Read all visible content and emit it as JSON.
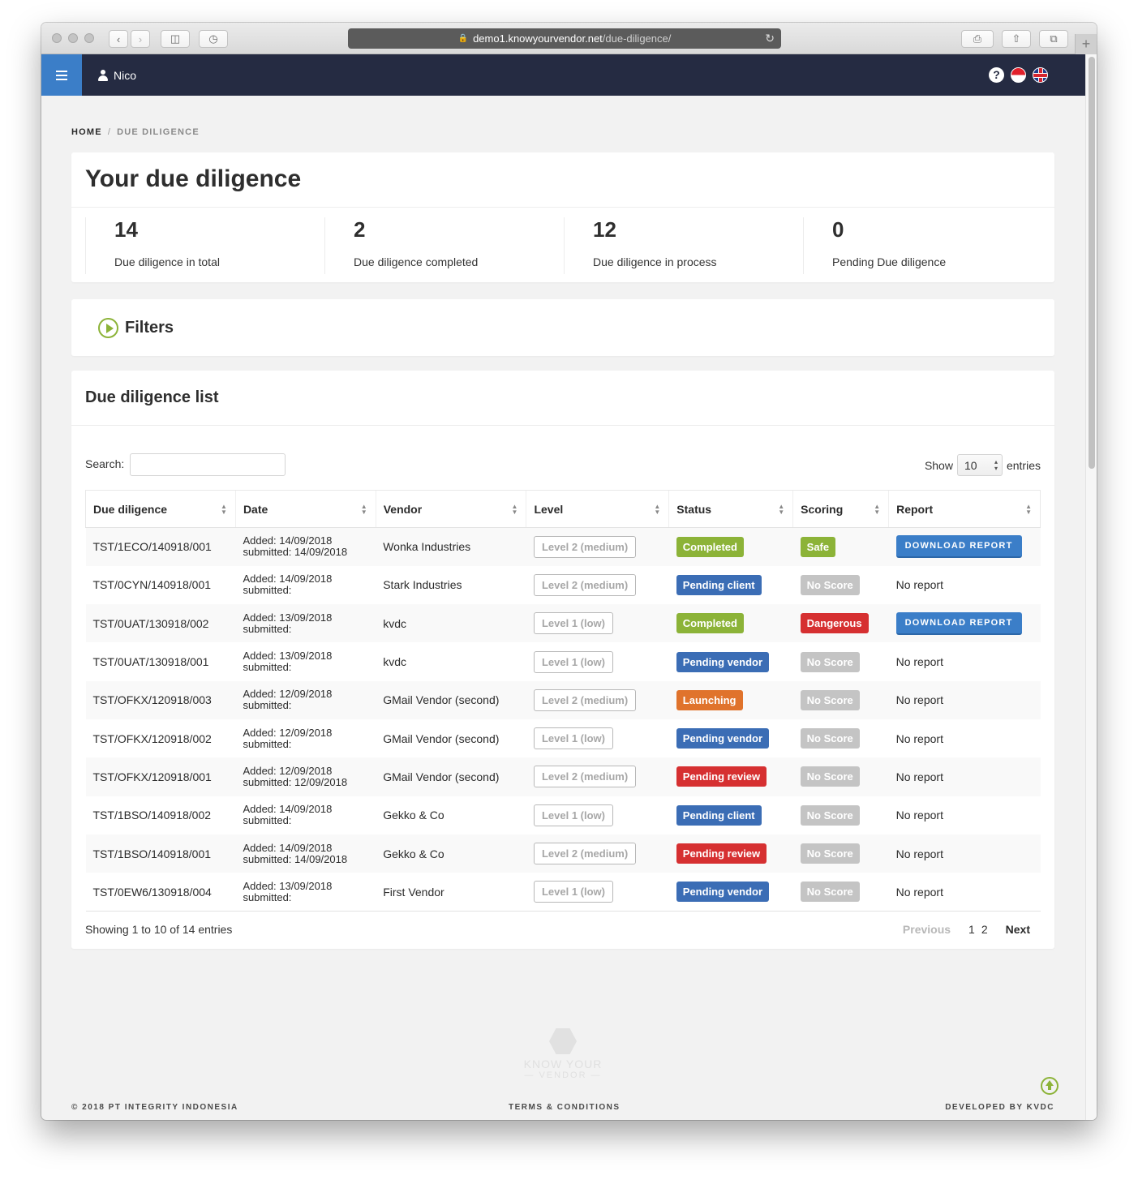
{
  "browser": {
    "url_host": "demo1.knowyourvendor.net",
    "url_path": "/due-diligence/"
  },
  "topbar": {
    "user_name": "Nico",
    "help_glyph": "?",
    "icons": [
      "menu-icon",
      "user-icon",
      "help-icon",
      "flag-indonesia-icon",
      "flag-uk-icon"
    ],
    "accent_color": "#3b7ec8",
    "bar_color": "#252b42"
  },
  "breadcrumb": {
    "home": "HOME",
    "separator": "/",
    "current": "DUE DILIGENCE"
  },
  "summary": {
    "title": "Your due diligence",
    "stats": [
      {
        "value": "14",
        "label": "Due diligence in total"
      },
      {
        "value": "2",
        "label": "Due diligence completed"
      },
      {
        "value": "12",
        "label": "Due diligence in process"
      },
      {
        "value": "0",
        "label": "Pending Due diligence"
      }
    ]
  },
  "filters": {
    "title": "Filters"
  },
  "list": {
    "title": "Due diligence list",
    "search_label": "Search:",
    "search_value": "",
    "show_label": "Show",
    "page_length": "10",
    "entries_label": "entries",
    "columns": [
      "Due diligence",
      "Date",
      "Vendor",
      "Level",
      "Status",
      "Scoring",
      "Report"
    ],
    "rows": [
      {
        "id": "TST/1ECO/140918/001",
        "added": "Added: 14/09/2018",
        "submitted": "submitted: 14/09/2018",
        "vendor": "Wonka Industries",
        "level": "Level 2 (medium)",
        "status": "Completed",
        "status_color": "#8cb338",
        "scoring": "Safe",
        "scoring_color": "#8cb338",
        "report": "DOWNLOAD REPORT",
        "report_type": "button"
      },
      {
        "id": "TST/0CYN/140918/001",
        "added": "Added: 14/09/2018",
        "submitted": "submitted:",
        "vendor": "Stark Industries",
        "level": "Level 2 (medium)",
        "status": "Pending client",
        "status_color": "#3b6db5",
        "scoring": "No Score",
        "scoring_color": "#c4c4c4",
        "report": "No report",
        "report_type": "text"
      },
      {
        "id": "TST/0UAT/130918/002",
        "added": "Added: 13/09/2018",
        "submitted": "submitted:",
        "vendor": "kvdc",
        "level": "Level 1 (low)",
        "status": "Completed",
        "status_color": "#8cb338",
        "scoring": "Dangerous",
        "scoring_color": "#d63031",
        "report": "DOWNLOAD REPORT",
        "report_type": "button"
      },
      {
        "id": "TST/0UAT/130918/001",
        "added": "Added: 13/09/2018",
        "submitted": "submitted:",
        "vendor": "kvdc",
        "level": "Level 1 (low)",
        "status": "Pending vendor",
        "status_color": "#3b6db5",
        "scoring": "No Score",
        "scoring_color": "#c4c4c4",
        "report": "No report",
        "report_type": "text"
      },
      {
        "id": "TST/OFKX/120918/003",
        "added": "Added: 12/09/2018",
        "submitted": "submitted:",
        "vendor": "GMail Vendor (second)",
        "level": "Level 2 (medium)",
        "status": "Launching",
        "status_color": "#e0732c",
        "scoring": "No Score",
        "scoring_color": "#c4c4c4",
        "report": "No report",
        "report_type": "text"
      },
      {
        "id": "TST/OFKX/120918/002",
        "added": "Added: 12/09/2018",
        "submitted": "submitted:",
        "vendor": "GMail Vendor (second)",
        "level": "Level 1 (low)",
        "status": "Pending vendor",
        "status_color": "#3b6db5",
        "scoring": "No Score",
        "scoring_color": "#c4c4c4",
        "report": "No report",
        "report_type": "text"
      },
      {
        "id": "TST/OFKX/120918/001",
        "added": "Added: 12/09/2018",
        "submitted": "submitted: 12/09/2018",
        "vendor": "GMail Vendor (second)",
        "level": "Level 2 (medium)",
        "status": "Pending review",
        "status_color": "#d63031",
        "scoring": "No Score",
        "scoring_color": "#c4c4c4",
        "report": "No report",
        "report_type": "text"
      },
      {
        "id": "TST/1BSO/140918/002",
        "added": "Added: 14/09/2018",
        "submitted": "submitted:",
        "vendor": "Gekko & Co",
        "level": "Level 1 (low)",
        "status": "Pending client",
        "status_color": "#3b6db5",
        "scoring": "No Score",
        "scoring_color": "#c4c4c4",
        "report": "No report",
        "report_type": "text"
      },
      {
        "id": "TST/1BSO/140918/001",
        "added": "Added: 14/09/2018",
        "submitted": "submitted: 14/09/2018",
        "vendor": "Gekko & Co",
        "level": "Level 2 (medium)",
        "status": "Pending review",
        "status_color": "#d63031",
        "scoring": "No Score",
        "scoring_color": "#c4c4c4",
        "report": "No report",
        "report_type": "text"
      },
      {
        "id": "TST/0EW6/130918/004",
        "added": "Added: 13/09/2018",
        "submitted": "submitted:",
        "vendor": "First Vendor",
        "level": "Level 1 (low)",
        "status": "Pending vendor",
        "status_color": "#3b6db5",
        "scoring": "No Score",
        "scoring_color": "#c4c4c4",
        "report": "No report",
        "report_type": "text"
      }
    ],
    "info": "Showing 1 to 10 of 14 entries",
    "pagination": {
      "previous": "Previous",
      "pages": [
        "1",
        "2"
      ],
      "next": "Next"
    }
  },
  "footer": {
    "logo_line1": "KNOW YOUR",
    "logo_line2": "— VENDOR —",
    "copyright": "© 2018 PT INTEGRITY INDONESIA",
    "terms": "TERMS & CONDITIONS",
    "developer": "DEVELOPED BY KVDC"
  }
}
